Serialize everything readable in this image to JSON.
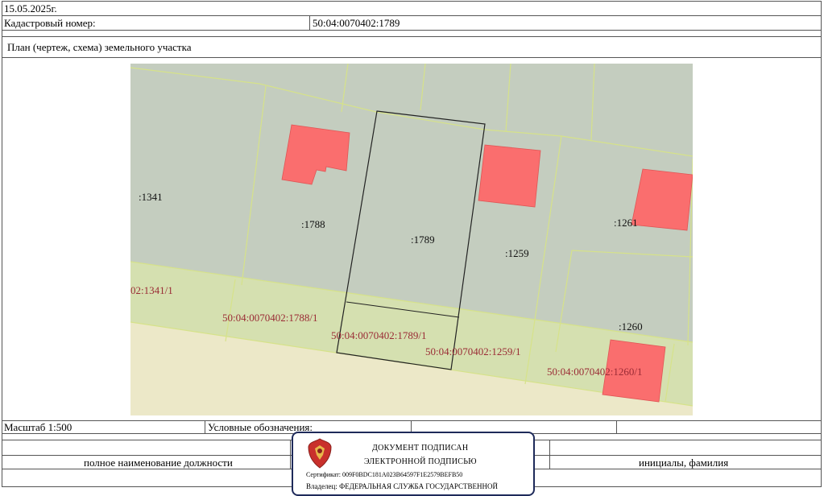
{
  "header": {
    "date": "15.05.2025г.",
    "cadastral_label": "Кадастровый номер:",
    "cadastral_value": "50:04:0070402:1789"
  },
  "plan": {
    "title": "План (чертеж, схема) земельного участка"
  },
  "map": {
    "parcel_labels": [
      ":1341",
      ":1788",
      ":1789",
      ":1259",
      ":1261",
      ":1260"
    ],
    "part_labels": [
      "02:1341/1",
      "50:04:0070402:1788/1",
      "50:04:0070402:1789/1",
      "50:04:0070402:1259/1",
      "50:04:0070402:1260/1"
    ],
    "colors": {
      "parcel_fill": "#c4cdbf",
      "strip_fill": "#d5e0b0",
      "road_fill": "#ece8c8",
      "building_fill": "#fa6e6e",
      "boundary": "#d6e28a",
      "selected_boundary": "#222222",
      "part_label": "#9a2b35"
    }
  },
  "footer": {
    "scale": "Масштаб 1:500",
    "legend_label": "Условные обозначения:",
    "position_label": "полное наименование должности",
    "name_label": "инициалы, фамилия"
  },
  "stamp": {
    "title": "ДОКУМЕНТ ПОДПИСАН",
    "subtitle": "ЭЛЕКТРОННОЙ ПОДПИСЬЮ",
    "certificate": "Сертификат: 009F0BDC181A023B64597F1E2579BEFB50",
    "owner": "Владелец: ФЕДЕРАЛЬНАЯ СЛУЖБА ГОСУДАРСТВЕННОЙ"
  }
}
